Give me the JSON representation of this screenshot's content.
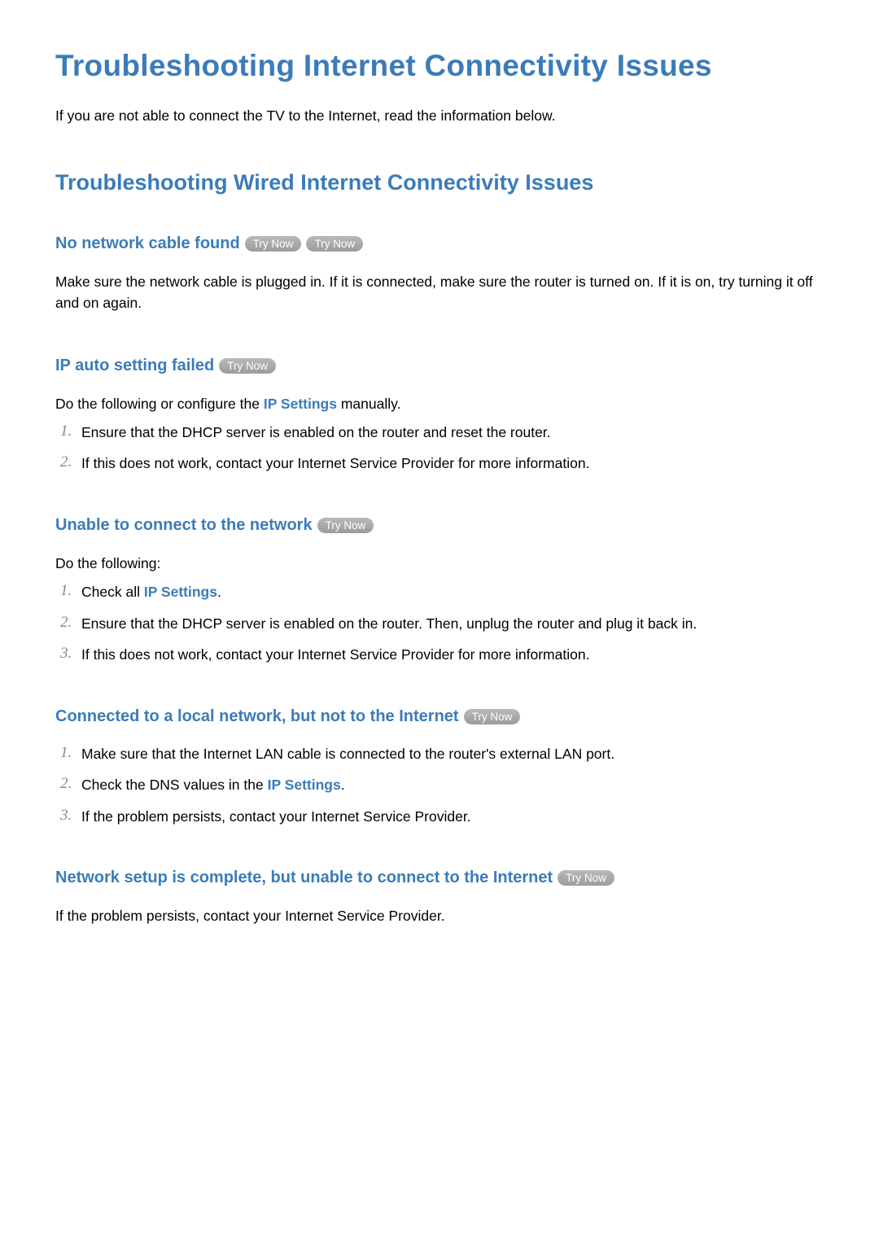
{
  "page_title": "Troubleshooting Internet Connectivity Issues",
  "intro": "If you are not able to connect the TV to the Internet, read the information below.",
  "section_heading": "Troubleshooting Wired Internet Connectivity Issues",
  "try_now": "Try Now",
  "ip_settings_label": "IP Settings",
  "sections": {
    "no_cable": {
      "title": "No network cable found",
      "text": "Make sure the network cable is plugged in. If it is connected, make sure the router is turned on. If it is on, try turning it off and on again."
    },
    "ip_auto": {
      "title": "IP auto setting failed",
      "lead_pre": "Do the following or configure the ",
      "lead_post": " manually.",
      "item1": "Ensure that the DHCP server is enabled on the router and reset the router.",
      "item2": "If this does not work, contact your Internet Service Provider for more information."
    },
    "unable_connect": {
      "title": "Unable to connect to the network",
      "lead": "Do the following:",
      "item1_pre": "Check all ",
      "item1_post": ".",
      "item2": "Ensure that the DHCP server is enabled on the router. Then, unplug the router and plug it back in.",
      "item3": "If this does not work, contact your Internet Service Provider for more information."
    },
    "local_only": {
      "title": "Connected to a local network, but not to the Internet",
      "item1": "Make sure that the Internet LAN cable is connected to the router's external LAN port.",
      "item2_pre": "Check the DNS values in the ",
      "item2_post": ".",
      "item3": "If the problem persists, contact your Internet Service Provider."
    },
    "setup_complete": {
      "title": "Network setup is complete, but unable to connect to the Internet",
      "text": "If the problem persists, contact your Internet Service Provider."
    }
  }
}
